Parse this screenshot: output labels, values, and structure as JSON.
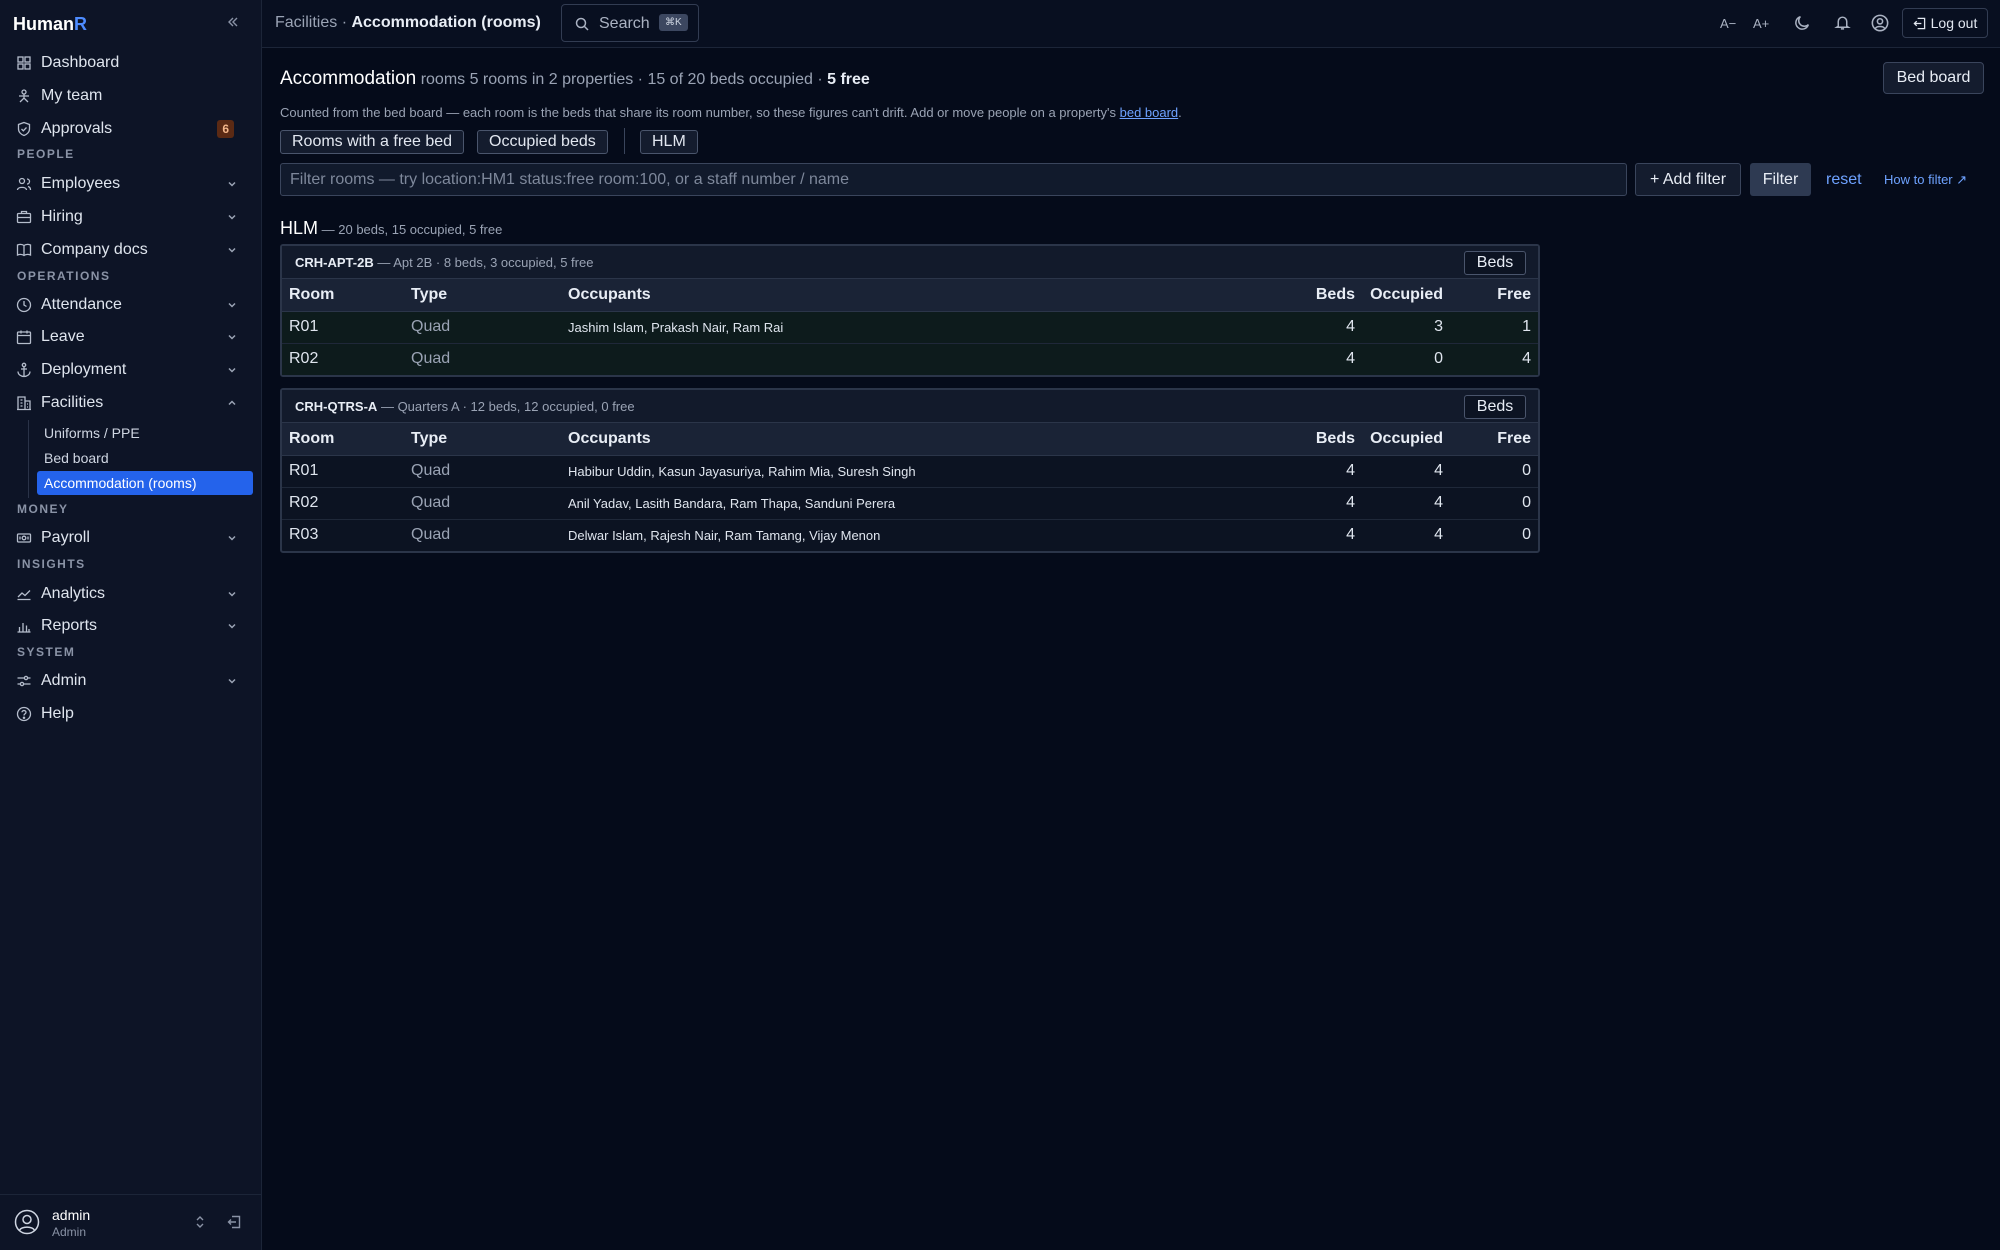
{
  "app": {
    "logo_main": "Human",
    "logo_accent": "R"
  },
  "sidebar": {
    "items": [
      {
        "label": "Dashboard"
      },
      {
        "label": "My team"
      },
      {
        "label": "Approvals",
        "badge": "6"
      },
      {
        "label": "Employees"
      },
      {
        "label": "Hiring"
      },
      {
        "label": "Company docs"
      },
      {
        "label": "Attendance"
      },
      {
        "label": "Leave"
      },
      {
        "label": "Deployment"
      },
      {
        "label": "Facilities"
      },
      {
        "label": "Payroll"
      },
      {
        "label": "Analytics"
      },
      {
        "label": "Reports"
      },
      {
        "label": "Admin"
      },
      {
        "label": "Help"
      }
    ],
    "sections": [
      "PEOPLE",
      "OPERATIONS",
      "MONEY",
      "INSIGHTS",
      "SYSTEM"
    ],
    "facilities_sub": [
      "Uniforms / PPE",
      "Bed board",
      "Accommodation (rooms)"
    ],
    "user": {
      "name": "admin",
      "role": "Admin"
    }
  },
  "topbar": {
    "crumb_parent": "Facilities",
    "crumb_sep": "·",
    "crumb_current": "Accommodation (rooms)",
    "search_label": "Search",
    "search_kbd": "⌘K",
    "font_dec": "A−",
    "font_inc": "A+",
    "logout_label": "Log out"
  },
  "page": {
    "title": "Accommodation",
    "summary": "rooms 5 rooms in 2 properties · 15 of 20 beds occupied ·",
    "free_summary": "5 free",
    "bedboard_button": "Bed board",
    "note_text": "Counted from the bed board — each room is the beds that share its room number, so these figures can't drift. Add or move people on a property's",
    "note_link": "bed board",
    "note_end": ".",
    "chips": [
      "Rooms with a free bed",
      "Occupied beds",
      "HLM"
    ],
    "filter_placeholder": "Filter rooms — try location:HM1 status:free room:100, or a staff number / name",
    "add_filter": "+ Add filter",
    "filter_button": "Filter",
    "reset": "reset",
    "how_to": "How to filter ↗"
  },
  "group": {
    "name": "HLM",
    "summary": "— 20 beds, 15 occupied, 5 free"
  },
  "table_headers": {
    "room": "Room",
    "type": "Type",
    "occupants": "Occupants",
    "beds": "Beds",
    "occupied": "Occupied",
    "free": "Free"
  },
  "properties": [
    {
      "code": "CRH-APT-2B",
      "summary": "— Apt 2B · 8 beds, 3 occupied, 5 free",
      "beds_button": "Beds",
      "rows": [
        {
          "room": "R01",
          "type": "Quad",
          "occupants": "Jashim Islam, Prakash Nair, Ram Rai",
          "beds": "4",
          "occupied": "3",
          "free": "1"
        },
        {
          "room": "R02",
          "type": "Quad",
          "occupants": "",
          "beds": "4",
          "occupied": "0",
          "free": "4"
        }
      ]
    },
    {
      "code": "CRH-QTRS-A",
      "summary": "— Quarters A · 12 beds, 12 occupied, 0 free",
      "beds_button": "Beds",
      "rows": [
        {
          "room": "R01",
          "type": "Quad",
          "occupants": "Habibur Uddin, Kasun Jayasuriya, Rahim Mia, Suresh Singh",
          "beds": "4",
          "occupied": "4",
          "free": "0"
        },
        {
          "room": "R02",
          "type": "Quad",
          "occupants": "Anil Yadav, Lasith Bandara, Ram Thapa, Sanduni Perera",
          "beds": "4",
          "occupied": "4",
          "free": "0"
        },
        {
          "room": "R03",
          "type": "Quad",
          "occupants": "Delwar Islam, Rajesh Nair, Ram Tamang, Vijay Menon",
          "beds": "4",
          "occupied": "4",
          "free": "0"
        }
      ]
    }
  ]
}
